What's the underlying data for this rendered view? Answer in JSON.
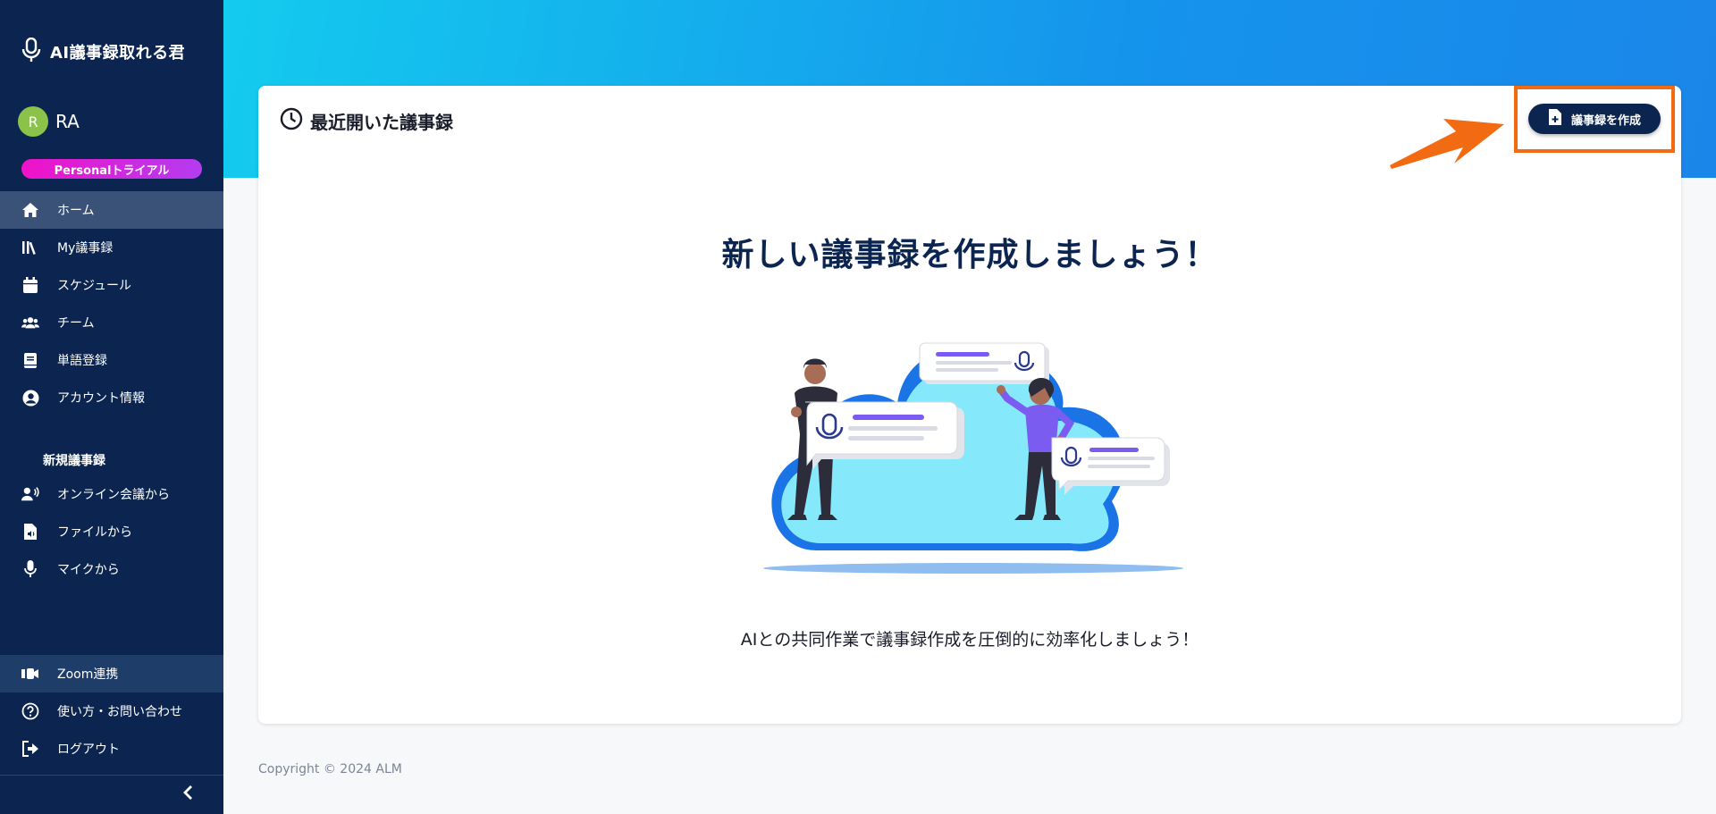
{
  "app": {
    "title": "AI議事録取れる君"
  },
  "user": {
    "initial": "R",
    "name": "RA",
    "plan": "Personalトライアル"
  },
  "sidebar": {
    "items": [
      {
        "label": "ホーム",
        "icon": "home-icon"
      },
      {
        "label": "My議事録",
        "icon": "library-icon"
      },
      {
        "label": "スケジュール",
        "icon": "calendar-icon"
      },
      {
        "label": "チーム",
        "icon": "team-icon"
      },
      {
        "label": "単語登録",
        "icon": "book-icon"
      },
      {
        "label": "アカウント情報",
        "icon": "user-circle-icon"
      }
    ],
    "section_title": "新規議事録",
    "new_items": [
      {
        "label": "オンライン会議から",
        "icon": "speaker-icon"
      },
      {
        "label": "ファイルから",
        "icon": "audio-file-icon"
      },
      {
        "label": "マイクから",
        "icon": "mic-icon"
      }
    ],
    "bottom_items": [
      {
        "label": "Zoom連携",
        "icon": "zoom-icon"
      },
      {
        "label": "使い方・お問い合わせ",
        "icon": "help-icon"
      },
      {
        "label": "ログアウト",
        "icon": "logout-icon"
      }
    ]
  },
  "main": {
    "card_title": "最近開いた議事録",
    "create_button": "議事録を作成",
    "hero_title": "新しい議事録を作成しましょう！",
    "subtitle": "AIとの共同作業で議事録作成を圧倒的に効率化しましょう！"
  },
  "footer": {
    "copyright": "Copyright © 2024 ALM"
  },
  "colors": {
    "sidebar": "#0b2550",
    "accent": "#1594ec",
    "highlight": "#f26a12",
    "badge": "#f012c8"
  }
}
